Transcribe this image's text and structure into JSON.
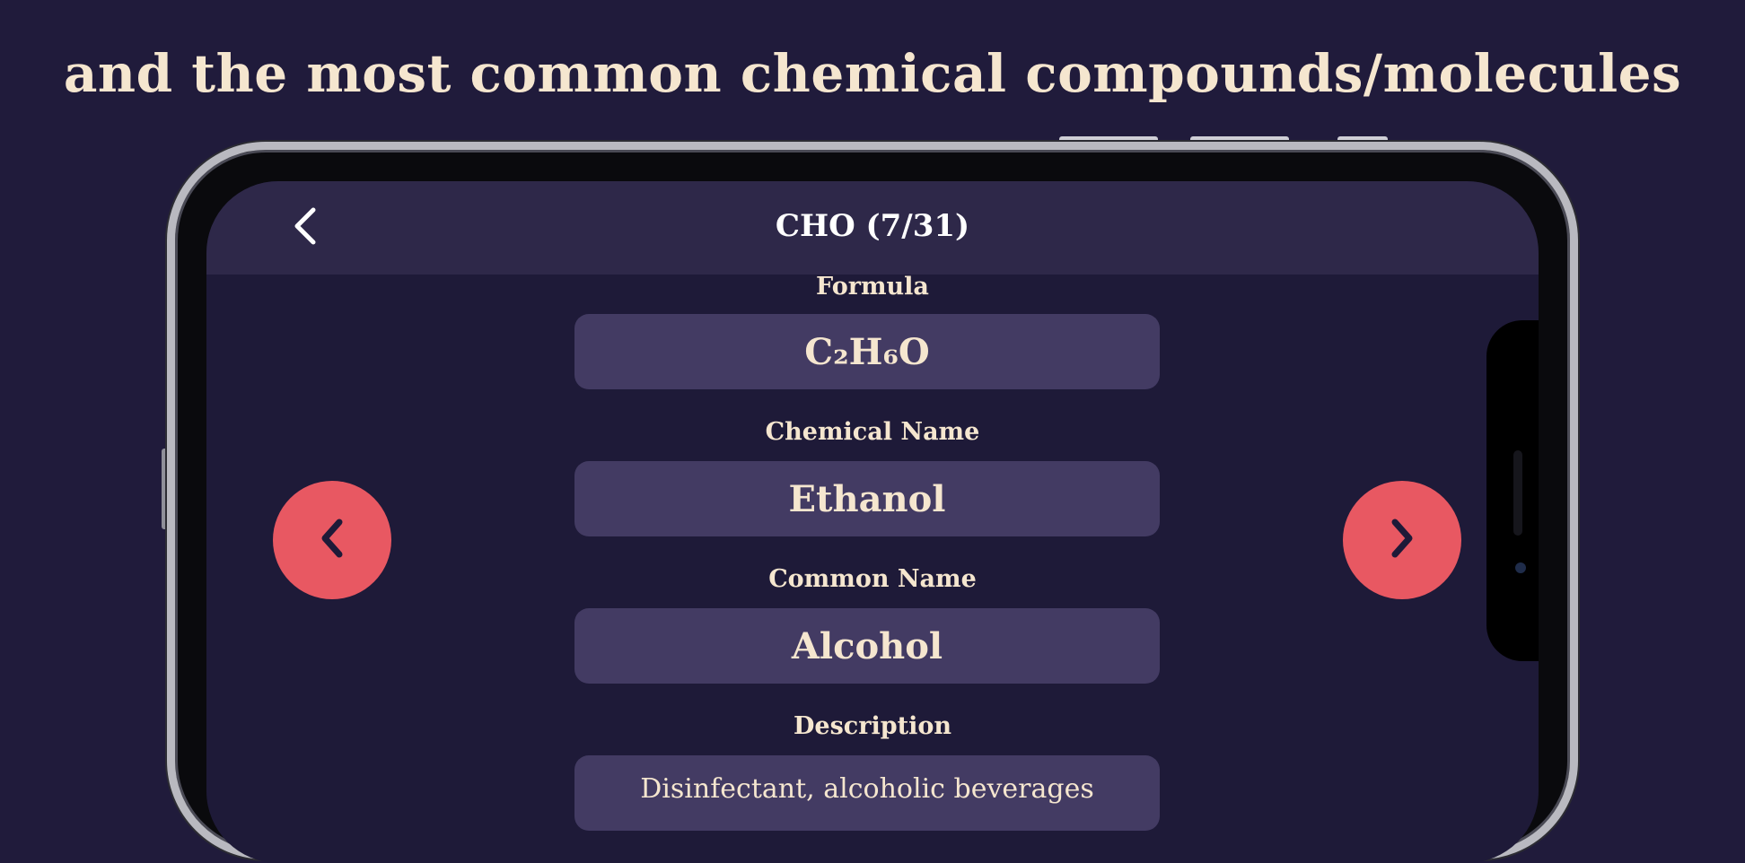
{
  "headline": "and the most common chemical compounds/molecules",
  "appbar": {
    "title": "CHO (7/31)",
    "back_icon": "chevron-left-icon"
  },
  "fields": {
    "formula_label": "Formula",
    "formula_value": "C₂H₆O",
    "chemical_name_label": "Chemical Name",
    "chemical_name_value": "Ethanol",
    "common_name_label": "Common Name",
    "common_name_value": "Alcohol",
    "description_label": "Description",
    "description_value": "Disinfectant, alcoholic beverages"
  },
  "navigation": {
    "previous_icon": "chevron-left-icon",
    "next_icon": "chevron-right-icon"
  },
  "colors": {
    "background": "#201b3b",
    "appbar": "#2e2849",
    "field": "#433b63",
    "accent": "#e85862",
    "text": "#f5e6cf"
  }
}
